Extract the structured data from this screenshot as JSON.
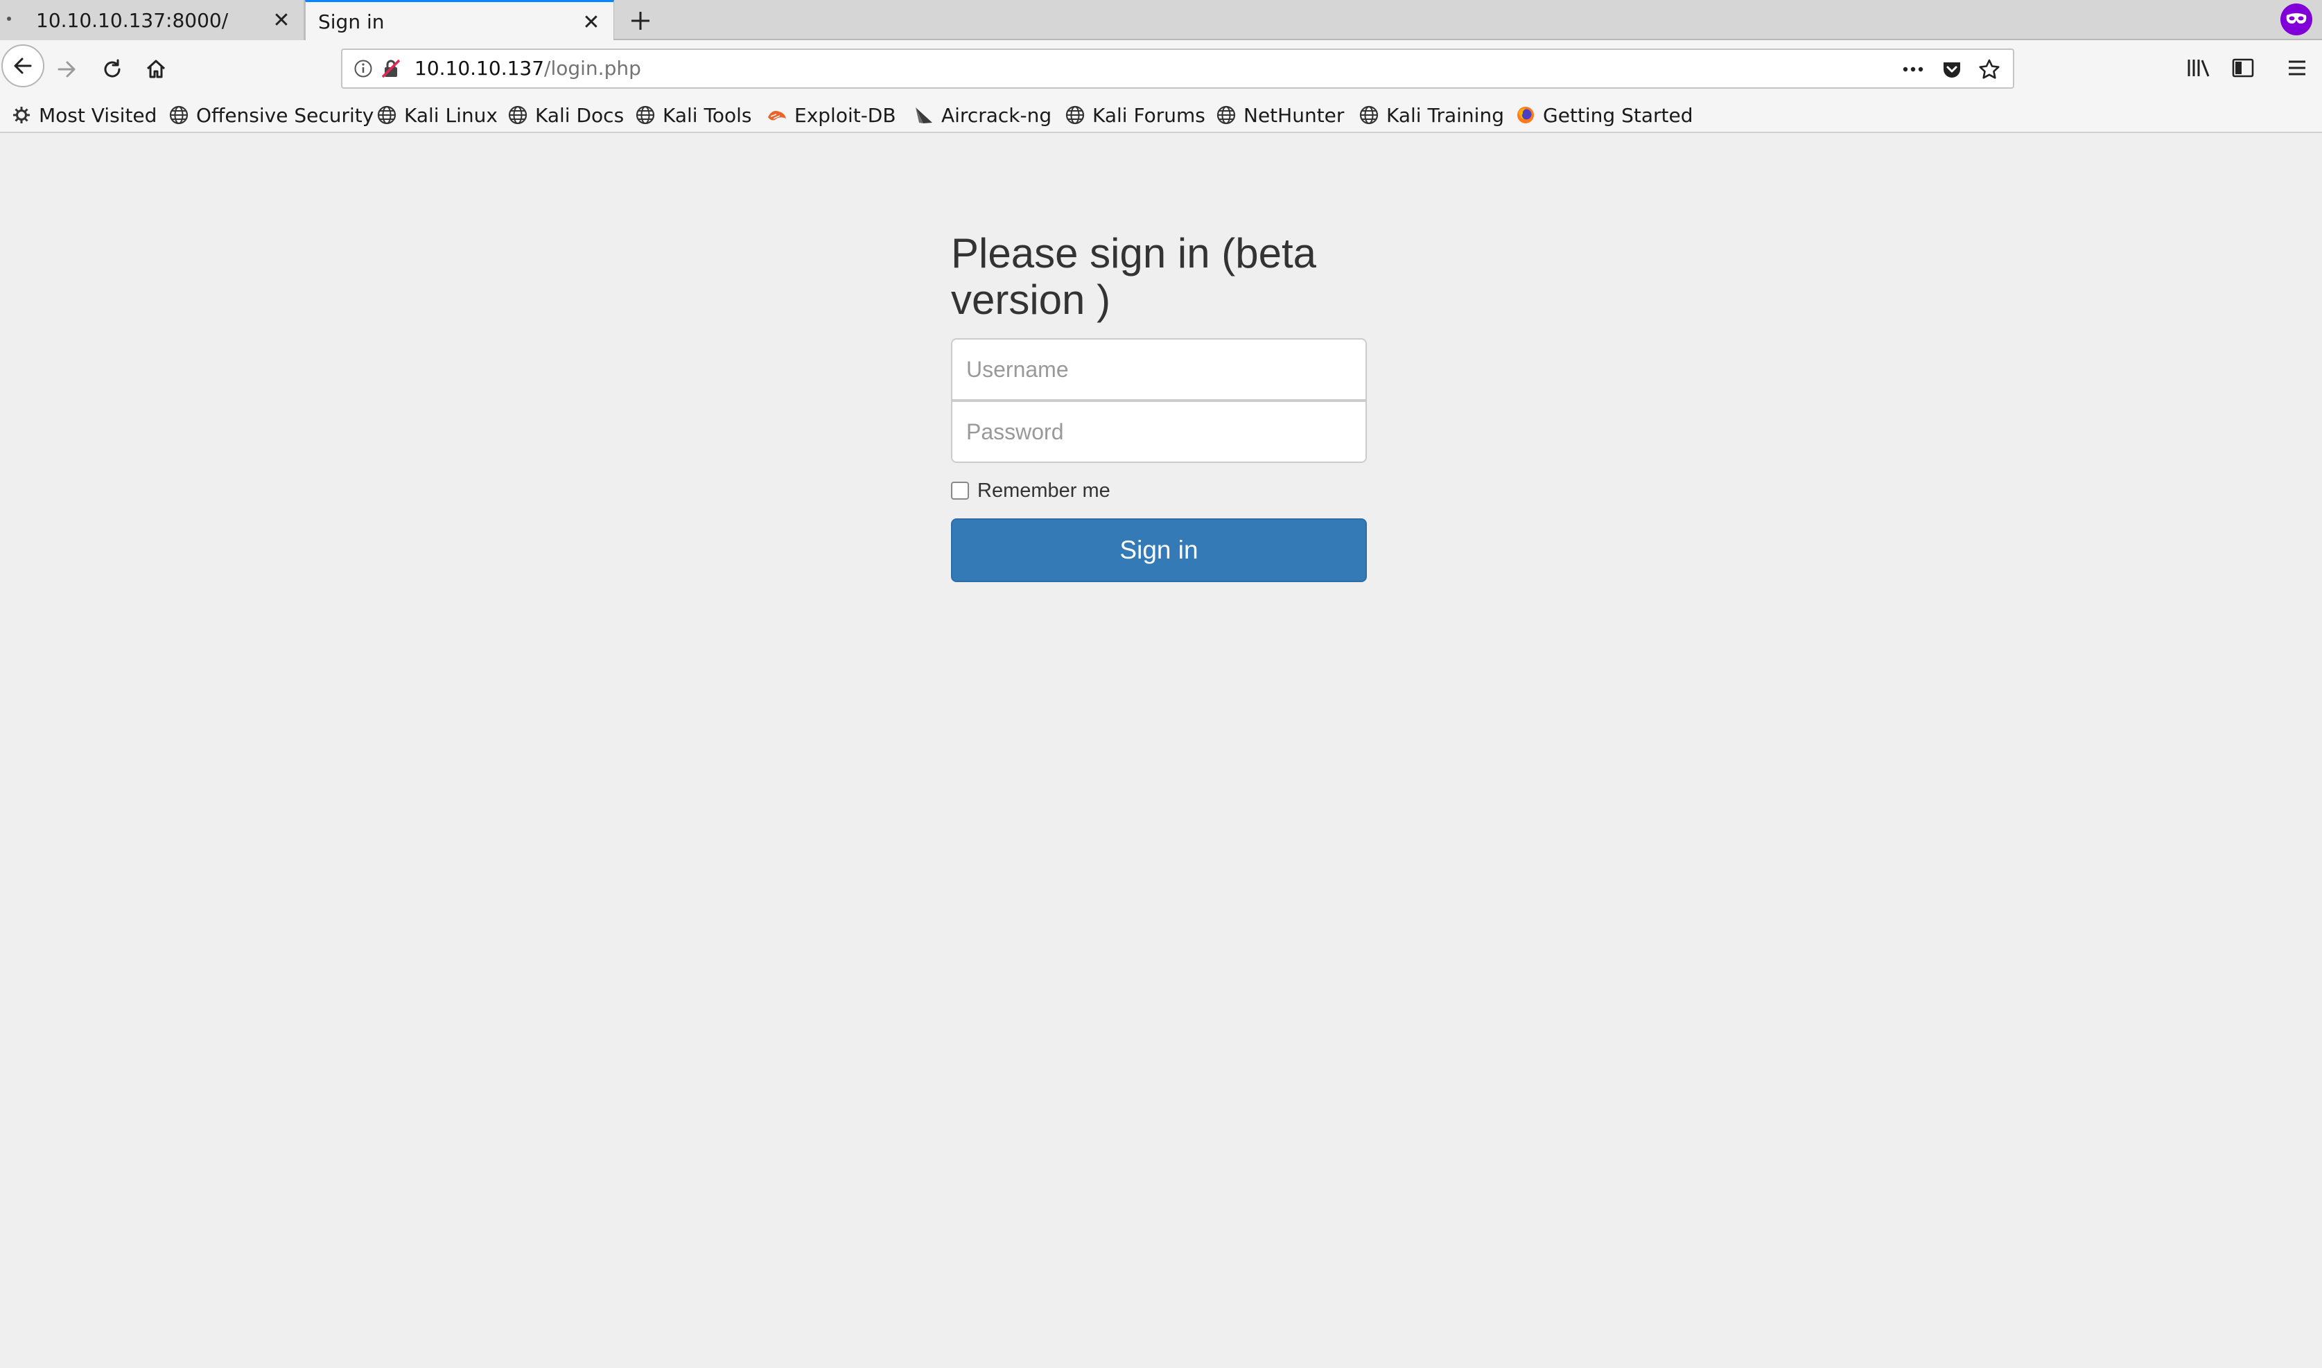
{
  "browser": {
    "tabs": [
      {
        "title": "10.10.10.137:8000/",
        "active": false
      },
      {
        "title": "Sign in",
        "active": true
      }
    ],
    "url": {
      "host": "10.10.10.137",
      "path": "/login.php"
    },
    "bookmarks": [
      {
        "label": "Most Visited",
        "icon": "gear-icon"
      },
      {
        "label": "Offensive Security",
        "icon": "globe-icon"
      },
      {
        "label": "Kali Linux",
        "icon": "globe-icon"
      },
      {
        "label": "Kali Docs",
        "icon": "globe-icon"
      },
      {
        "label": "Kali Tools",
        "icon": "globe-icon"
      },
      {
        "label": "Exploit-DB",
        "icon": "exploitdb-icon"
      },
      {
        "label": "Aircrack-ng",
        "icon": "aircrack-icon"
      },
      {
        "label": "Kali Forums",
        "icon": "globe-icon"
      },
      {
        "label": "NetHunter",
        "icon": "globe-icon"
      },
      {
        "label": "Kali Training",
        "icon": "globe-icon"
      },
      {
        "label": "Getting Started",
        "icon": "firefox-icon"
      }
    ],
    "colors": {
      "accent": "#0a84ff",
      "private_badge": "#8000d7"
    }
  },
  "page": {
    "heading": "Please sign in (beta version )",
    "username_placeholder": "Username",
    "password_placeholder": "Password",
    "remember_label": "Remember me",
    "submit_label": "Sign in",
    "colors": {
      "button": "#337ab7",
      "background": "#efefef"
    }
  }
}
